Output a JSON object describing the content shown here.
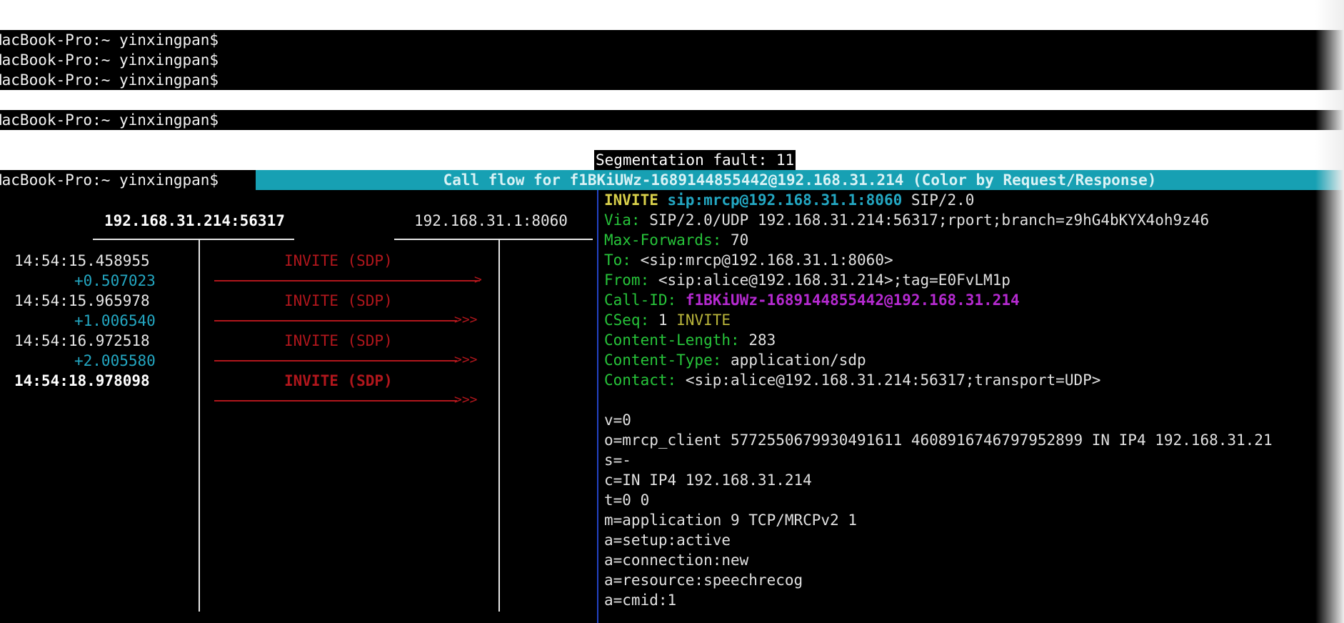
{
  "terminal": {
    "prompts": [
      "MacBook-Pro:~ yinxingpan$",
      "MacBook-Pro:~ yinxingpan$",
      "MacBook-Pro:~ yinxingpan$",
      "MacBook-Pro:~ yinxingpan$",
      "MacBook-Pro:~ yinxingpan$"
    ],
    "segfault": "Segmentation fault: 11"
  },
  "sngrep": {
    "title": "Call flow for f1BKiUWz-1689144855442@192.168.31.214 (Color by Request/Response)",
    "hosts": [
      "192.168.31.214:56317",
      "192.168.31.1:8060"
    ],
    "messages": [
      {
        "time": "14:54:15.458955",
        "delta": "+0.507023",
        "label": "INVITE (SDP)",
        "head": ">"
      },
      {
        "time": "14:54:15.965978",
        "delta": "+1.006540",
        "label": "INVITE (SDP)",
        "head": ">>>"
      },
      {
        "time": "14:54:16.972518",
        "delta": "+2.005580",
        "label": "INVITE (SDP)",
        "head": ">>>"
      },
      {
        "time": "14:54:18.978098",
        "delta": "",
        "label": "INVITE (SDP)",
        "head": ">>>"
      }
    ],
    "detail": {
      "request_method": "INVITE",
      "request_uri": "sip:mrcp@192.168.31.1:8060",
      "request_version": "SIP/2.0",
      "headers": [
        {
          "name": "Via:",
          "value": "SIP/2.0/UDP 192.168.31.214:56317;rport;branch=z9hG4bKYX4oh9z46"
        },
        {
          "name": "Max-Forwards:",
          "value": "70"
        },
        {
          "name": "To:",
          "value": "<sip:mrcp@192.168.31.1:8060>"
        },
        {
          "name": "From:",
          "value": "<sip:alice@192.168.31.214>;tag=E0FvLM1p"
        },
        {
          "name": "Call-ID:",
          "value": "f1BKiUWz-1689144855442@192.168.31.214"
        },
        {
          "name": "CSeq:",
          "value": "1",
          "value2": "INVITE"
        },
        {
          "name": "Content-Length:",
          "value": "283"
        },
        {
          "name": "Content-Type:",
          "value": "application/sdp"
        },
        {
          "name": "Contact:",
          "value": "<sip:alice@192.168.31.214:56317;transport=UDP>"
        }
      ],
      "sdp": [
        "v=0",
        "o=mrcp_client 5772550679930491611 4608916746797952899 IN IP4 192.168.31.21",
        "s=-",
        "c=IN IP4 192.168.31.214",
        "t=0 0",
        "m=application 9 TCP/MRCPv2 1",
        "a=setup:active",
        "a=connection:new",
        "a=resource:speechrecog",
        "a=cmid:1"
      ]
    },
    "colors": {
      "title_bg": "#17a0b3",
      "arrow": "#b1161c",
      "header_name": "#27c43a",
      "call_id": "#b52ad0",
      "method": "#d8cf4a",
      "uri": "#23a7c2",
      "divider": "#2342c4"
    }
  }
}
